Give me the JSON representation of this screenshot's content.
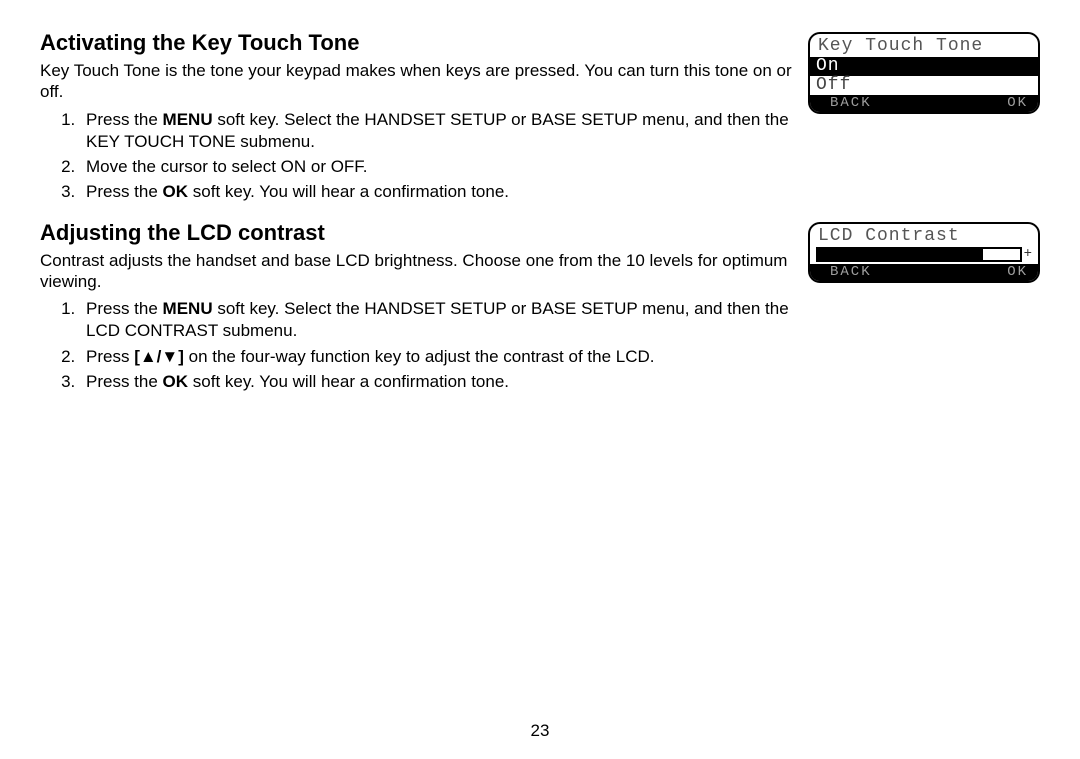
{
  "page_number": "23",
  "section1": {
    "heading": "Activating the Key Touch Tone",
    "intro": "Key Touch Tone is the tone your keypad makes when keys are pressed. You can turn this tone on or off.",
    "step1_a": "Press the ",
    "step1_menu": "MENU",
    "step1_b": " soft key. Select the HANDSET SETUP or BASE SETUP menu, and then the KEY TOUCH TONE submenu.",
    "step2": "Move the cursor to select ON or OFF.",
    "step3_a": "Press the ",
    "step3_ok": "OK",
    "step3_b": " soft key. You will hear a confirmation tone."
  },
  "lcd1": {
    "title": "Key Touch Tone",
    "opt_on": "On",
    "opt_off": "Off",
    "back": "BACK",
    "ok": "OK"
  },
  "section2": {
    "heading": "Adjusting the LCD contrast",
    "intro": "Contrast adjusts the handset and base LCD brightness. Choose one from the 10 levels for optimum viewing.",
    "step1_a": "Press the ",
    "step1_menu": "MENU",
    "step1_b": " soft key. Select the HANDSET SETUP or BASE SETUP menu, and then the LCD CONTRAST submenu.",
    "step2_a": "Press ",
    "step2_keys": "[▲/▼]",
    "step2_b": " on the four-way function key to adjust the contrast of the LCD.",
    "step3_a": "Press the ",
    "step3_ok": "OK",
    "step3_b": " soft key. You will hear a confirmation tone."
  },
  "lcd2": {
    "title": "LCD Contrast",
    "plus": "+",
    "back": "BACK",
    "ok": "OK"
  }
}
